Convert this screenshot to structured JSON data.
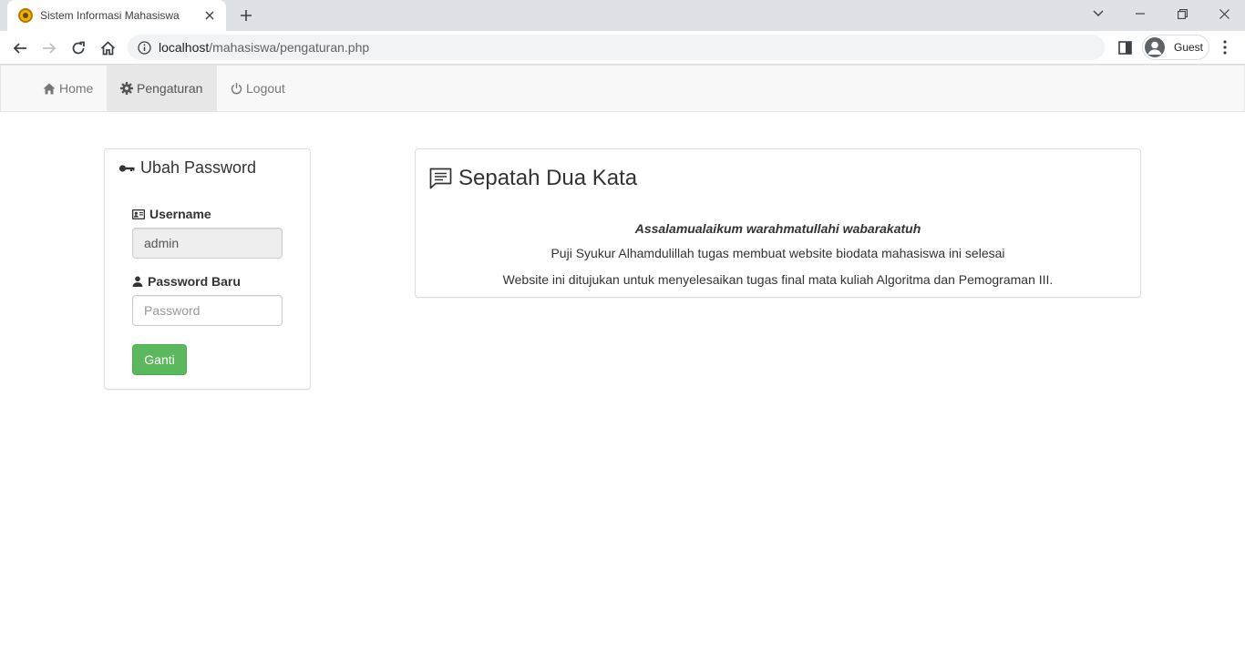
{
  "browser": {
    "tab_title": "Sistem Informasi Mahasiswa",
    "url_host": "localhost",
    "url_path": "/mahasiswa/pengaturan.php",
    "profile_label": "Guest"
  },
  "navbar": {
    "items": [
      {
        "label": "Home",
        "icon": "home-icon"
      },
      {
        "label": "Pengaturan",
        "icon": "gear-icon",
        "active": true
      },
      {
        "label": "Logout",
        "icon": "power-icon"
      }
    ]
  },
  "password_panel": {
    "title": "Ubah Password",
    "username_label": "Username",
    "username_value": "admin",
    "password_label": "Password Baru",
    "password_placeholder": "Password",
    "submit_label": "Ganti"
  },
  "welcome_panel": {
    "title": "Sepatah Dua Kata",
    "greeting": "Assalamualaikum warahmatullahi wabarakatuh",
    "line1": "Puji Syukur Alhamdulillah tugas membuat website biodata mahasiswa ini selesai",
    "line2": "Website ini ditujukan untuk menyelesaikan tugas final mata kuliah Algoritma dan Pemograman III."
  },
  "colors": {
    "button_success": "#5cb85c",
    "navbar_bg": "#f8f8f8",
    "navbar_active": "#e7e7e7"
  }
}
